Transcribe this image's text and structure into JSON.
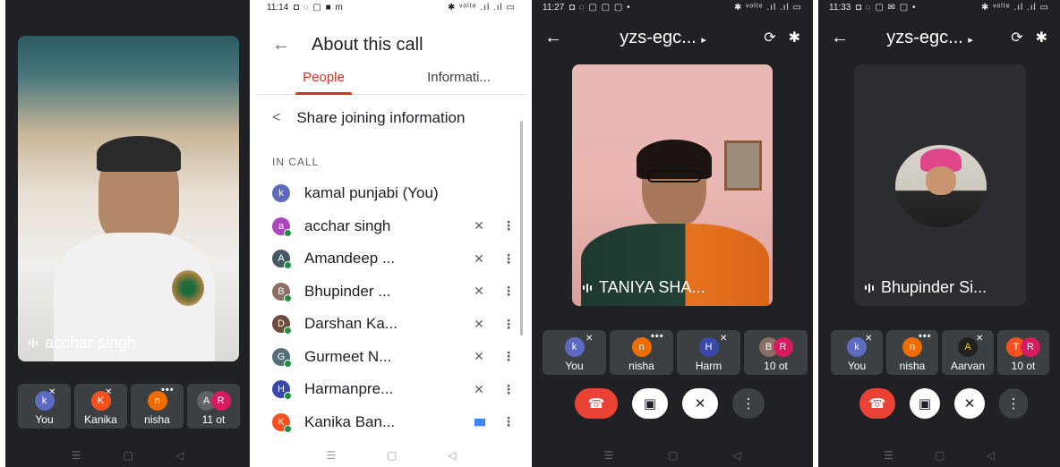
{
  "panel1": {
    "featured_name": "acchar singh",
    "strip": [
      {
        "letter": "k",
        "label": "You",
        "color": "#5c6bc0",
        "muted": true
      },
      {
        "letter": "K",
        "label": "Kanika",
        "color": "#f4511e",
        "muted": true
      },
      {
        "letter": "n",
        "label": "nisha",
        "color": "#ef6c00",
        "dots": true
      },
      {
        "letters": [
          "A",
          "R"
        ],
        "label": "11 ot",
        "colors": [
          "#5f6368",
          "#d81b60"
        ]
      }
    ]
  },
  "panel2": {
    "status_time": "11:14",
    "status_icons": "◘ ◌ ▢ ■ m",
    "status_right": "✱ ᵛᵒˡᵗᵉ .ıl .ıl ▭",
    "title": "About this call",
    "tabs": [
      "People",
      "Informati..."
    ],
    "share_label": "Share joining information",
    "in_call_label": "IN CALL",
    "people": [
      {
        "letter": "k",
        "name": "kamal punjabi (You)",
        "color": "#5c6bc0",
        "mic": "",
        "kebab": ""
      },
      {
        "letter": "a",
        "name": "acchar singh",
        "color": "#ab47bc",
        "mic": "🎙̸",
        "kebab": "⋮"
      },
      {
        "letter": "A",
        "name": "Amandeep ...",
        "color": "#455a64",
        "mic": "🎙̸",
        "kebab": "⋮"
      },
      {
        "letter": "B",
        "name": "Bhupinder ...",
        "color": "#8d6e63",
        "mic": "🎙̸",
        "kebab": "⋮"
      },
      {
        "letter": "D",
        "name": "Darshan Ka...",
        "color": "#6d4c41",
        "mic": "🎙̸",
        "kebab": "⋮"
      },
      {
        "letter": "G",
        "name": "Gurmeet N...",
        "color": "#546e7a",
        "mic": "🎙̸",
        "kebab": "⋮"
      },
      {
        "letter": "H",
        "name": "Harmanpre...",
        "color": "#3949ab",
        "mic": "🎙̸",
        "kebab": "⋮"
      },
      {
        "letter": "K",
        "name": "Kanika Ban...",
        "color": "#f4511e",
        "mic": "▮▮▮",
        "kebab": "⋮"
      }
    ]
  },
  "panel3": {
    "status_time": "11:27",
    "status_icons": "◘ ◌ ▢ ▢ ▢ •",
    "status_right": "✱ ᵛᵒˡᵗᵉ .ıl .ıl ▭",
    "meeting_code": "yzs-egc...",
    "featured_name": "TANIYA SHA...",
    "strip": [
      {
        "letter": "k",
        "label": "You",
        "color": "#5c6bc0",
        "muted": true
      },
      {
        "letter": "n",
        "label": "nisha",
        "color": "#ef6c00",
        "dots": true
      },
      {
        "letter": "H",
        "label": "Harm",
        "color": "#3949ab",
        "muted": true
      },
      {
        "letters": [
          "B",
          "R"
        ],
        "label": "10 ot",
        "colors": [
          "#8d6e63",
          "#d81b60"
        ]
      }
    ]
  },
  "panel4": {
    "status_time": "11:33",
    "status_icons": "◘ ◌ ▢ ✉ ▢ •",
    "status_right": "✱ ᵛᵒˡᵗᵉ .ıl .ıl ▭",
    "meeting_code": "yzs-egc...",
    "featured_name": "Bhupinder Si...",
    "strip": [
      {
        "letter": "k",
        "label": "You",
        "color": "#5c6bc0",
        "muted": true
      },
      {
        "letter": "n",
        "label": "nisha",
        "color": "#ef6c00",
        "dots": true
      },
      {
        "letter": "A",
        "label": "Aarvan",
        "color": "#212121",
        "muted": true
      },
      {
        "letters": [
          "T",
          "R"
        ],
        "label": "10 ot",
        "colors": [
          "#f4511e",
          "#d81b60"
        ]
      }
    ]
  },
  "nav": {
    "menu": "☰",
    "home": "▢",
    "back": "◁"
  },
  "icons": {
    "back": "←",
    "share": "<",
    "flip": "⟳",
    "bluetooth": "✱",
    "chevron": "▸",
    "end_call": "☎",
    "video_off": "▣",
    "mic_off": "🎙̸",
    "more": "⋮"
  }
}
